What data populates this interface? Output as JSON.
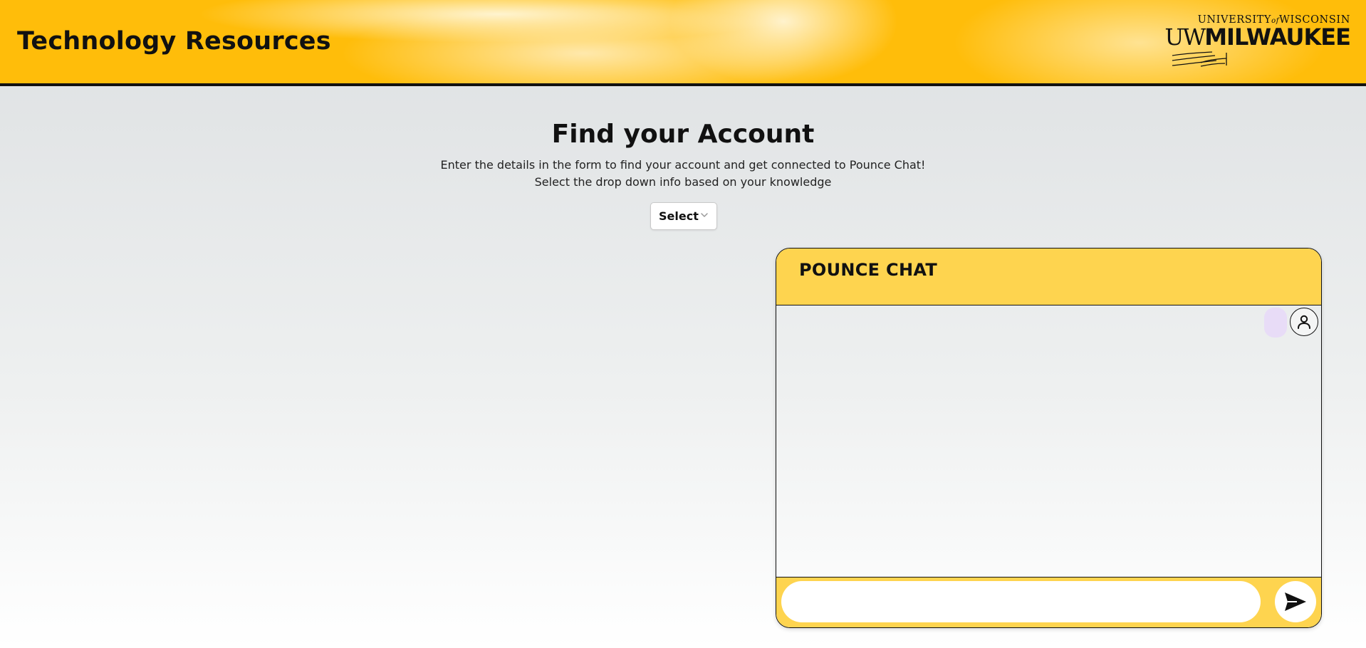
{
  "header": {
    "title": "Technology Resources",
    "logo": {
      "top_line_pre": "UNIVERSITY",
      "top_line_of": "of",
      "top_line_post": "WISCONSIN",
      "uw": "UW",
      "name": "MILWAUKEE"
    }
  },
  "main": {
    "heading": "Find your Account",
    "subtext_1": "Enter the details in the form to find your account and get connected to Pounce Chat!",
    "subtext_2": "Select the drop down info based on your knowledge",
    "select": {
      "label": "Select",
      "icon": "chevron-down-icon"
    }
  },
  "chat": {
    "title": "POUNCE CHAT",
    "input": {
      "value": "",
      "placeholder": ""
    },
    "icons": {
      "avatar": "user-icon",
      "send": "send-icon"
    }
  },
  "colors": {
    "header_bg": "#ffbd0a",
    "chat_accent": "#fed44f",
    "bubble": "#e8dcf7"
  }
}
